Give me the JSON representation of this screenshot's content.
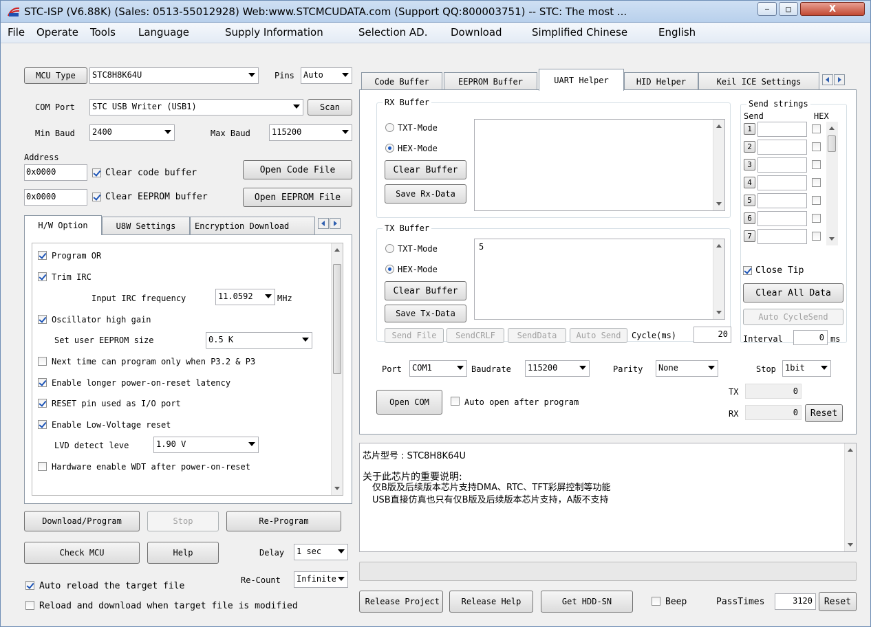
{
  "title": "STC-ISP (V6.88K) (Sales: 0513-55012928) Web:www.STCMCUDATA.com  (Support QQ:800003751) -- STC: The most ...",
  "window_buttons": {
    "minimize": "—",
    "maximize": "□",
    "close": "X"
  },
  "menu": [
    "File",
    "Operate",
    "Tools",
    "Language",
    "Supply Information",
    "Selection AD.",
    "Download",
    "Simplified Chinese",
    "English"
  ],
  "left": {
    "mcu_type_label": "MCU Type",
    "mcu_type_value": "STC8H8K64U",
    "pins_label": "Pins",
    "pins_value": "Auto",
    "com_port_label": "COM Port",
    "com_port_value": "STC USB Writer (USB1)",
    "scan_label": "Scan",
    "min_baud_label": "Min Baud",
    "min_baud_value": "2400",
    "max_baud_label": "Max Baud",
    "max_baud_value": "115200",
    "address_label": "Address",
    "code_address": "0x0000",
    "clear_code_label": "Clear code buffer",
    "open_code_label": "Open Code File",
    "eeprom_address": "0x0000",
    "clear_eeprom_label": "Clear EEPROM buffer",
    "open_eeprom_label": "Open EEPROM File",
    "tabs": [
      "H/W Option",
      "U8W Settings",
      "Encryption Download"
    ],
    "options": {
      "program_or": "Program OR",
      "trim_irc": "Trim IRC",
      "irc_freq_label": "Input IRC frequency",
      "irc_freq_value": "11.0592",
      "irc_freq_unit": "MHz",
      "osc_high_gain": "Oscillator high gain",
      "eeprom_size_label": "Set user EEPROM size",
      "eeprom_size_value": "0.5 K",
      "next_time": "Next time can program only when P3.2 & P3",
      "longer_por": "Enable longer power-on-reset latency",
      "reset_pin_io": "RESET pin used as I/O port",
      "low_voltage_reset": "Enable Low-Voltage reset",
      "lvd_label": "LVD detect leve",
      "lvd_value": "1.90 V",
      "hw_wdt": "Hardware enable WDT after power-on-reset"
    },
    "download_label": "Download/Program",
    "stop_label": "Stop",
    "reprogram_label": "Re-Program",
    "check_mcu_label": "Check MCU",
    "help_label": "Help",
    "delay_label": "Delay",
    "delay_value": "1 sec",
    "recount_label": "Re-Count",
    "recount_value": "Infinite",
    "auto_reload_label": "Auto reload the target file",
    "reload_modified_label": "Reload and download when target file is modified"
  },
  "right": {
    "tabs": [
      "Code Buffer",
      "EEPROM Buffer",
      "UART Helper",
      "HID Helper",
      "Keil ICE Settings"
    ],
    "rx_buffer_title": "RX Buffer",
    "txt_mode": "TXT-Mode",
    "hex_mode": "HEX-Mode",
    "clear_buffer": "Clear Buffer",
    "save_rx": "Save Rx-Data",
    "tx_buffer_title": "TX Buffer",
    "tx_content": "5",
    "save_tx": "Save Tx-Data",
    "send_file": "Send File",
    "send_crlf": "SendCRLF",
    "send_data": "SendData",
    "auto_send": "Auto Send",
    "cycle_label": "Cycle(ms)",
    "cycle_value": "20",
    "send_strings_title": "Send strings",
    "send_col": "Send",
    "hex_col": "HEX",
    "send_rows": [
      "1",
      "2",
      "3",
      "4",
      "5",
      "6",
      "7"
    ],
    "close_tip": "Close Tip",
    "clear_all": "Clear All Data",
    "auto_cycle": "Auto CycleSend",
    "interval_label": "Interval",
    "interval_value": "0",
    "interval_unit": "ms",
    "port_label": "Port",
    "port_value": "COM1",
    "baudrate_label": "Baudrate",
    "baudrate_value": "115200",
    "parity_label": "Parity",
    "parity_value": "None",
    "stop_label": "Stop",
    "stop_value": "1bit",
    "open_com": "Open COM",
    "auto_open": "Auto open after program",
    "tx_label": "TX",
    "tx_count": "0",
    "rx_label": "RX",
    "rx_count": "0",
    "reset_label": "Reset"
  },
  "info": {
    "line1": "芯片型号 : STC8H8K64U",
    "line2": "关于此芯片的重要说明:",
    "line3": "仅B版及后续版本芯片支持DMA、RTC、TFT彩屏控制等功能",
    "line4": "USB直接仿真也只有仅B版及后续版本芯片支持，A版不支持"
  },
  "bottom": {
    "release_project": "Release Project",
    "release_help": "Release Help",
    "get_hdd": "Get HDD-SN",
    "beep": "Beep",
    "passtimes_label": "PassTimes",
    "passtimes_value": "3120",
    "reset": "Reset"
  }
}
